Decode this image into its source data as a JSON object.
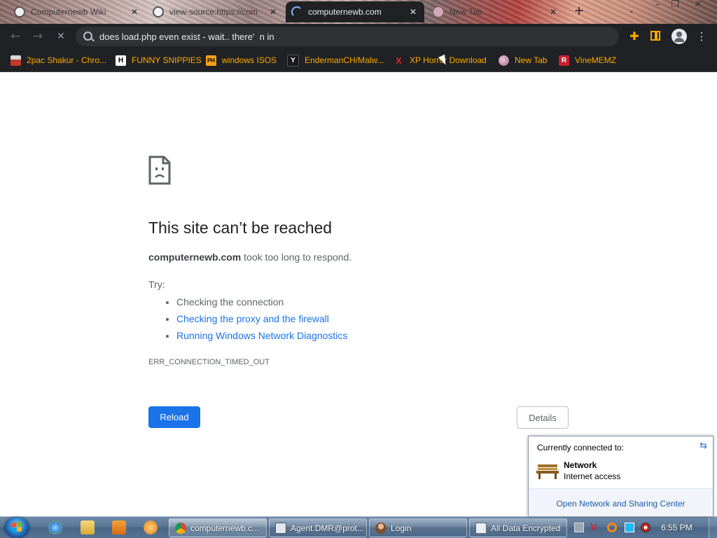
{
  "browser": {
    "tabs": [
      {
        "title": "Computernewb Wiki",
        "close": "✕",
        "icon": "ghost-icon"
      },
      {
        "title": "view-source:https://com",
        "close": "✕",
        "icon": "ghost-icon"
      },
      {
        "title": "computernewb.com",
        "close": "✕",
        "icon": "loading-spinner-icon",
        "active": true
      },
      {
        "title": "New Tab",
        "close": "✕",
        "icon": "globe-icon"
      }
    ],
    "new_tab_symbol": "+",
    "tab_search_symbol": "⌄",
    "window_controls": {
      "minimize": "–",
      "restore": "❐",
      "close": "✕"
    },
    "nav": {
      "back": "←",
      "forward": "→",
      "stop": "✕"
    },
    "omnibox_value": "does load.php even exist - wait.. there'  n in",
    "toolbar_icons": {
      "extensions": "✚",
      "menu": "⋮"
    },
    "accent_color": "#f9ab00",
    "bookmarks": [
      {
        "label": "2pac Shakur - Chro...",
        "icon": "2pac-favicon"
      },
      {
        "label": "FUNNY SNIPPIES",
        "icon": "H",
        "icon_name": "h-letter-favicon"
      },
      {
        "label": "windows ISOS",
        "icon": "PH",
        "icon_name": "ph-favicon"
      },
      {
        "label": "EndermanCH/Malw...",
        "icon": "Y",
        "icon_name": "y-favicon"
      },
      {
        "label": "XP Horror Download",
        "icon": "X",
        "icon_name": "x-favicon"
      },
      {
        "label": "New Tab",
        "icon": "globe-favicon"
      },
      {
        "label": "VineMEMZ",
        "icon": "R",
        "icon_name": "r-favicon"
      }
    ]
  },
  "error_page": {
    "title": "This site can’t be reached",
    "domain": "computernewb.com",
    "description": " took too long to respond.",
    "try_label": "Try:",
    "suggestions": [
      {
        "text": "Checking the connection",
        "link": false
      },
      {
        "text": "Checking the proxy and the firewall",
        "link": true
      },
      {
        "text": "Running Windows Network Diagnostics",
        "link": true
      }
    ],
    "error_code": "ERR_CONNECTION_TIMED_OUT",
    "reload_label": "Reload",
    "details_label": "Details",
    "link_color": "#1a73e8",
    "button_color": "#1a73e8"
  },
  "network_popup": {
    "heading": "Currently connected to:",
    "refresh_icon": "⇆",
    "network_name": "Network",
    "network_status": "Internet access",
    "link": "Open Network and Sharing Center"
  },
  "taskbar": {
    "buttons": [
      {
        "label": "computernewb.c...",
        "icon": "chrome-icon",
        "active": true
      },
      {
        "label": "Agent.DMR@prot...",
        "icon": "terminal-window-icon"
      },
      {
        "label": "Login",
        "icon": "login-user-icon"
      },
      {
        "label": "All Data Encrypted",
        "icon": "window-icon"
      }
    ],
    "clock": "6:55 PM",
    "tray_mark": "V"
  }
}
